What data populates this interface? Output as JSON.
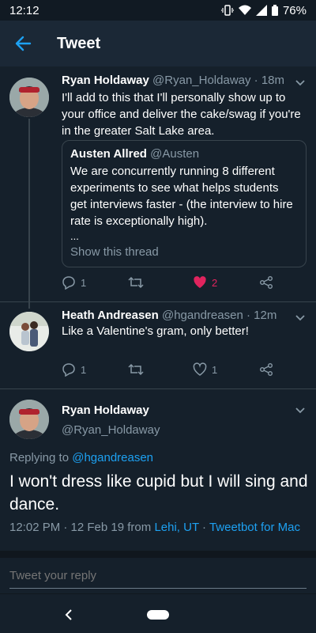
{
  "status_bar": {
    "time": "12:12",
    "battery": "76%"
  },
  "header": {
    "title": "Tweet"
  },
  "tweets": [
    {
      "name": "Ryan Holdaway",
      "handle": "@Ryan_Holdaway",
      "time": "· 18m",
      "text": "I'll add to this that I'll personally show up to your office and deliver the cake/swag if you're in the greater Salt Lake area.",
      "quote": {
        "name": "Austen Allred",
        "handle": "@Austen",
        "text": "We are concurrently running 8 different experiments to see what helps students get interviews faster - (the interview to hire rate is exceptionally high).",
        "ellipsis": "...",
        "show_thread": "Show this thread"
      },
      "replies": "1",
      "likes": "2"
    },
    {
      "name": "Heath Andreasen",
      "handle": "@hgandreasen",
      "time": "· 12m",
      "text": "Like a Valentine's gram, only better!",
      "replies": "1",
      "likes": "1"
    }
  ],
  "main_tweet": {
    "name": "Ryan Holdaway",
    "handle": "@Ryan_Holdaway",
    "replying_prefix": "Replying to",
    "replying_to": "@hgandreasen",
    "text": "I won't dress like cupid but I will sing and dance.",
    "timestamp": "12:02 PM · 12 Feb 19 from",
    "location": "Lehi, UT",
    "separator": "·",
    "client": "Tweetbot for Mac"
  },
  "reply": {
    "placeholder": "Tweet your reply"
  },
  "colors": {
    "background": "#15202b",
    "accent": "#1da1f2",
    "like": "#e0245e",
    "muted": "#8899a6"
  }
}
